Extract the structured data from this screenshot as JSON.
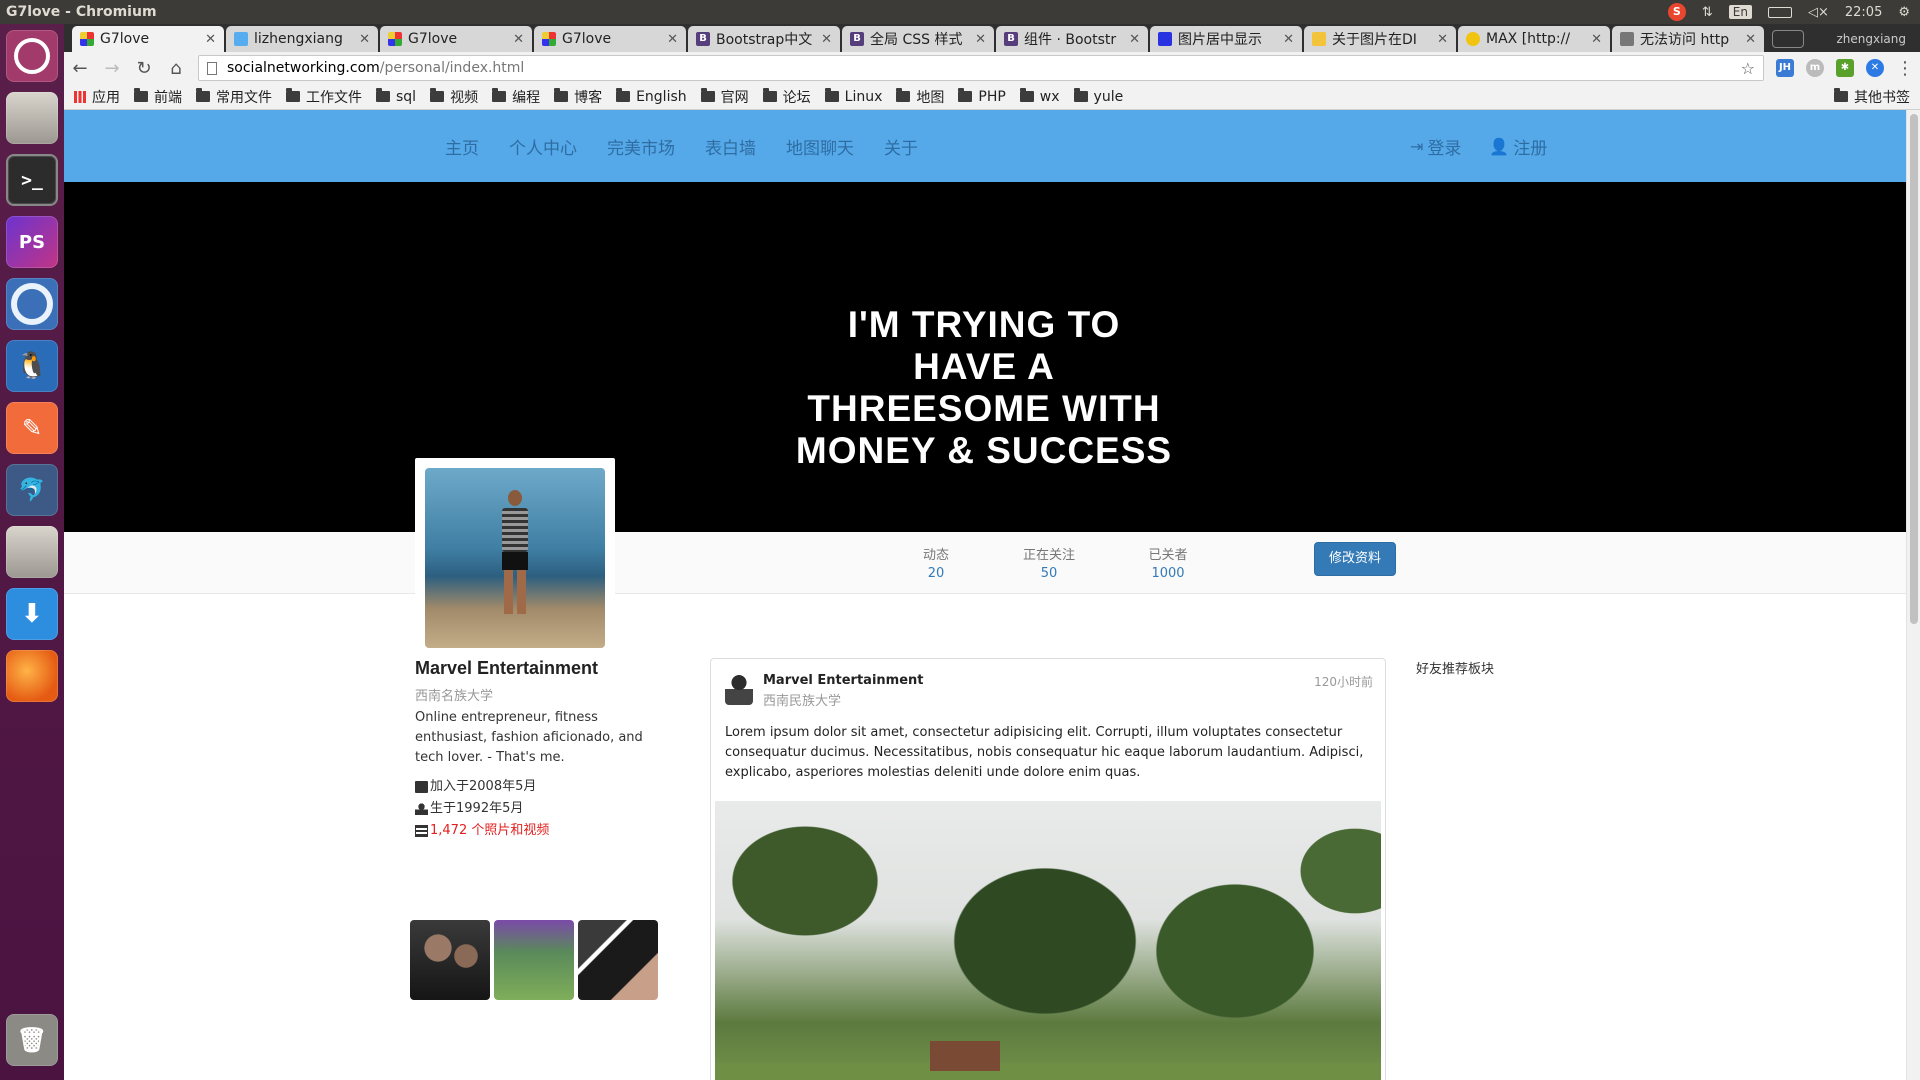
{
  "os": {
    "window_title": "G7love - Chromium",
    "tray": {
      "lang": "En",
      "time": "22:05",
      "user": "zhengxiang"
    }
  },
  "tabs": [
    {
      "label": "G7love",
      "icon": "g7",
      "active": true
    },
    {
      "label": "lizhengxiang",
      "icon": "tw"
    },
    {
      "label": "G7love",
      "icon": "g7"
    },
    {
      "label": "G7love",
      "icon": "g7"
    },
    {
      "label": "Bootstrap中文",
      "icon": "b"
    },
    {
      "label": "全局 CSS 样式",
      "icon": "b"
    },
    {
      "label": "组件 · Bootstr",
      "icon": "b"
    },
    {
      "label": "图片居中显示",
      "icon": "paw"
    },
    {
      "label": "关于图片在DI",
      "icon": "hand"
    },
    {
      "label": "MAX [http://",
      "icon": "smile"
    },
    {
      "label": "无法访问 http",
      "icon": "page"
    }
  ],
  "address": {
    "host": "socialnetworking.com",
    "path": "/personal/index.html"
  },
  "bookmarks": {
    "apps": "应用",
    "items": [
      "前端",
      "常用文件",
      "工作文件",
      "sql",
      "视频",
      "编程",
      "博客",
      "English",
      "官网",
      "论坛",
      "Linux",
      "地图",
      "PHP",
      "wx",
      "yule"
    ],
    "other": "其他书签"
  },
  "site": {
    "nav": [
      "主页",
      "个人中心",
      "完美市场",
      "表白墙",
      "地图聊天",
      "关于"
    ],
    "login": "登录",
    "register": "注册",
    "cover_lines": [
      "I'M TRYING TO",
      "HAVE A",
      "THREESOME WITH",
      "MONEY & SUCCESS"
    ],
    "stats": [
      {
        "label": "动态",
        "value": "20"
      },
      {
        "label": "正在关注",
        "value": "50"
      },
      {
        "label": "已关者",
        "value": "1000"
      }
    ],
    "edit_button": "修改资料"
  },
  "profile": {
    "name": "Marvel Entertainment",
    "school": "西南名族大学",
    "bio": "Online entrepreneur, fitness enthusiast, fashion aficionado, and tech lover. - That's me.",
    "joined": "加入于2008年5月",
    "born": "生于1992年5月",
    "media": "1,472 个照片和视频"
  },
  "post": {
    "author": "Marvel Entertainment",
    "school": "西南民族大学",
    "time": "120小时前",
    "body": "Lorem ipsum dolor sit amet, consectetur adipisicing elit. Corrupti, illum voluptates consectetur consequatur ducimus. Necessitatibus, nobis consequatur hic eaque laborum laudantium. Adipisci, explicabo, asperiores molestias deleniti unde dolore enim quas."
  },
  "friends_panel": "好友推荐板块"
}
